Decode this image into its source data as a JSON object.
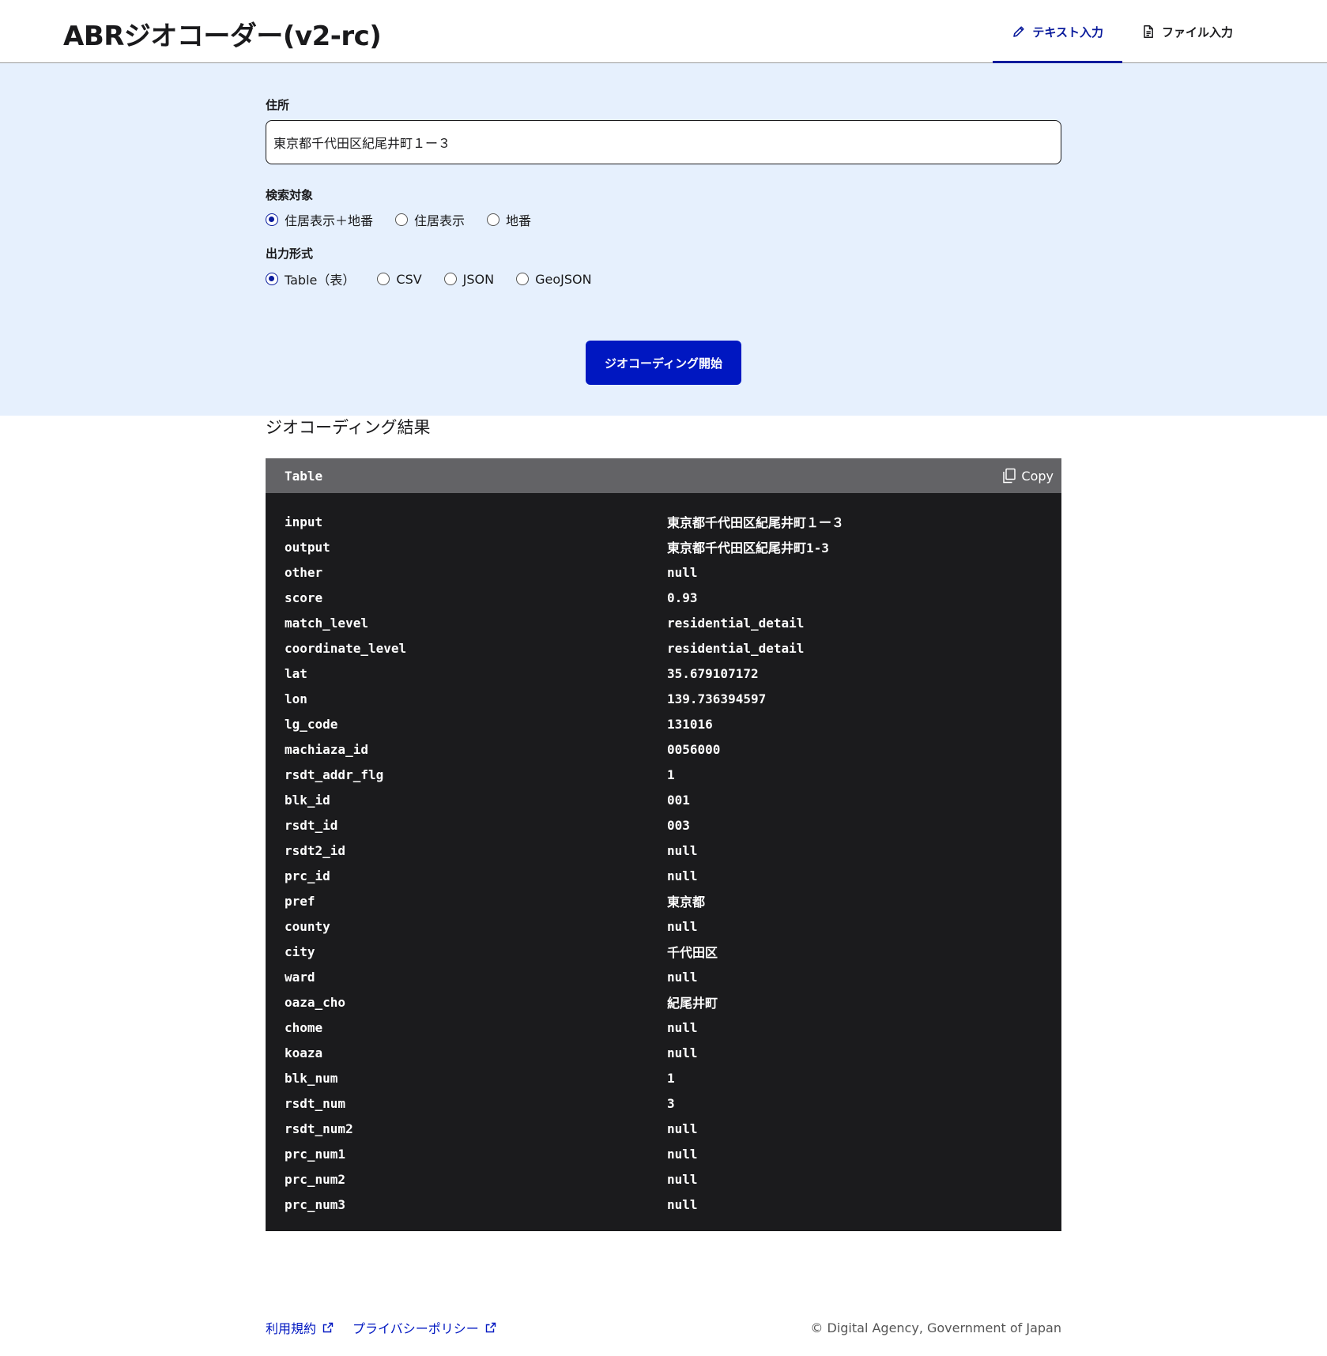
{
  "header": {
    "title": "ABRジオコーダー(v2-rc)",
    "tabs": [
      {
        "label": "テキスト入力",
        "icon": "pencil-icon",
        "active": true
      },
      {
        "label": "ファイル入力",
        "icon": "document-icon",
        "active": false
      }
    ]
  },
  "form": {
    "address_label": "住所",
    "address_value": "東京都千代田区紀尾井町１ー３",
    "target_label": "検索対象",
    "target_options": [
      "住居表示＋地番",
      "住居表示",
      "地番"
    ],
    "target_selected": "住居表示＋地番",
    "output_label": "出力形式",
    "output_options": [
      "Table（表）",
      "CSV",
      "JSON",
      "GeoJSON"
    ],
    "output_selected": "Table（表）",
    "submit_label": "ジオコーディング開始"
  },
  "results": {
    "title": "ジオコーディング結果",
    "format_label": "Table",
    "copy_label": "Copy",
    "rows": [
      {
        "key": "input",
        "value": "東京都千代田区紀尾井町１ー３"
      },
      {
        "key": "output",
        "value": "東京都千代田区紀尾井町1-3"
      },
      {
        "key": "other",
        "value": "null"
      },
      {
        "key": "score",
        "value": "0.93"
      },
      {
        "key": "match_level",
        "value": "residential_detail"
      },
      {
        "key": "coordinate_level",
        "value": "residential_detail"
      },
      {
        "key": "lat",
        "value": "35.679107172"
      },
      {
        "key": "lon",
        "value": "139.736394597"
      },
      {
        "key": "lg_code",
        "value": "131016"
      },
      {
        "key": "machiaza_id",
        "value": "0056000"
      },
      {
        "key": "rsdt_addr_flg",
        "value": "1"
      },
      {
        "key": "blk_id",
        "value": "001"
      },
      {
        "key": "rsdt_id",
        "value": "003"
      },
      {
        "key": "rsdt2_id",
        "value": "null"
      },
      {
        "key": "prc_id",
        "value": "null"
      },
      {
        "key": "pref",
        "value": "東京都"
      },
      {
        "key": "county",
        "value": "null"
      },
      {
        "key": "city",
        "value": "千代田区"
      },
      {
        "key": "ward",
        "value": "null"
      },
      {
        "key": "oaza_cho",
        "value": "紀尾井町"
      },
      {
        "key": "chome",
        "value": "null"
      },
      {
        "key": "koaza",
        "value": "null"
      },
      {
        "key": "blk_num",
        "value": "1"
      },
      {
        "key": "rsdt_num",
        "value": "3"
      },
      {
        "key": "rsdt_num2",
        "value": "null"
      },
      {
        "key": "prc_num1",
        "value": "null"
      },
      {
        "key": "prc_num2",
        "value": "null"
      },
      {
        "key": "prc_num3",
        "value": "null"
      }
    ]
  },
  "footer": {
    "links": [
      {
        "label": "利用規約",
        "icon": "external-link-icon"
      },
      {
        "label": "プライバシーポリシー",
        "icon": "external-link-icon"
      }
    ],
    "copyright": "© Digital Agency, Government of Japan"
  },
  "colors": {
    "accent": "#0017c1",
    "tab_active": "#0a1b9c",
    "form_bg": "#e6f0fd",
    "code_bg": "#1b1b1d",
    "code_header_bg": "#636366"
  }
}
